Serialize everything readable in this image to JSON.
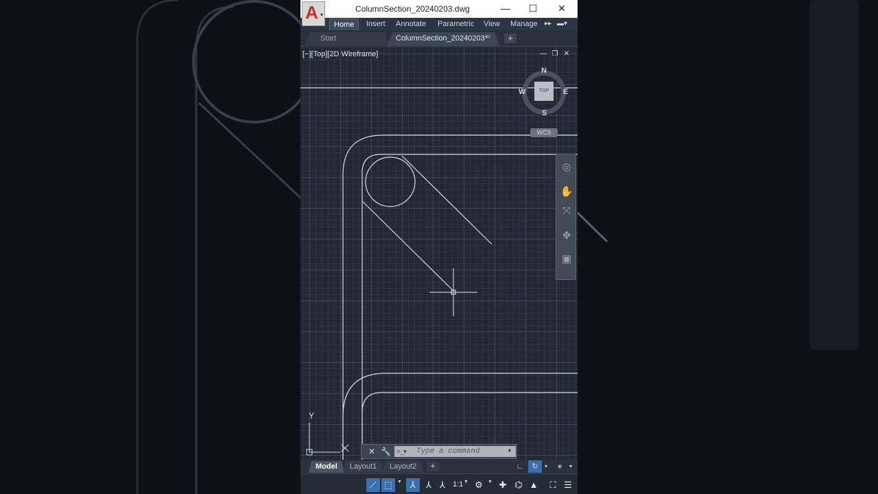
{
  "window": {
    "title": "ColumnSection_20240203.dwg",
    "logo_letter": "A",
    "minimize": "—",
    "maximize": "☐",
    "close": "✕"
  },
  "ribbon": {
    "tabs": [
      "Home",
      "Insert",
      "Annotate",
      "Parametric",
      "View",
      "Manage"
    ],
    "active_tab": "Home",
    "more_icon": "double-right-arrow-icon",
    "more_glyph": "▸▸"
  },
  "doc_tabs": {
    "start": "Start",
    "active": "ColumnSection_20240203*",
    "add": "+"
  },
  "viewport": {
    "label": "[−][Top][2D Wireframe]",
    "controls": [
      "—",
      "❐",
      "✕"
    ]
  },
  "viewcube": {
    "face": "TOP",
    "north": "N",
    "south": "S",
    "east": "E",
    "west": "W",
    "wcs": "WCS"
  },
  "ucs": {
    "y_label": "Y"
  },
  "command": {
    "placeholder": "Type a command",
    "prompt_glyph": ">_▾",
    "close_glyph": "✕",
    "custom_glyph": "🔧",
    "up_glyph": "▲"
  },
  "layouts": {
    "tabs": [
      "Model",
      "Layout1",
      "Layout2"
    ],
    "active": "Model",
    "add": "+"
  },
  "status": {
    "scale": "1:1"
  },
  "colors": {
    "canvas": "#222933",
    "accent": "#3c6fb0",
    "logo_red": "#d02b2b"
  }
}
